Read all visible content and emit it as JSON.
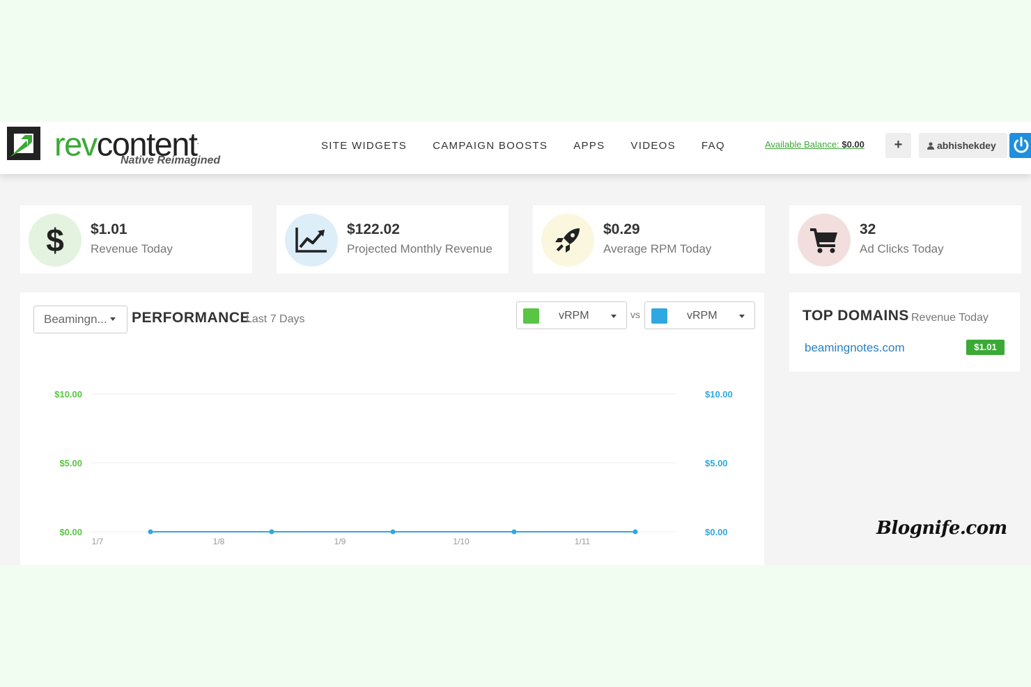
{
  "brand": {
    "name_prefix": "rev",
    "name_suffix": "content",
    "dot": ".",
    "tagline": "Native Reimagined",
    "accent_color": "#3aaa35"
  },
  "nav": {
    "items": [
      {
        "label": "SITE WIDGETS"
      },
      {
        "label": "CAMPAIGN BOOSTS"
      },
      {
        "label": "APPS"
      },
      {
        "label": "VIDEOS"
      },
      {
        "label": "FAQ"
      }
    ]
  },
  "account": {
    "balance_label": "Available Balance:",
    "balance_value": "$0.00",
    "add_label": "+",
    "username": "abhishekdey",
    "power_icon": "power-icon"
  },
  "stats": [
    {
      "value": "$1.01",
      "label": "Revenue Today",
      "icon": "dollar-icon",
      "circle_color": "#e3f3df"
    },
    {
      "value": "$122.02",
      "label": "Projected Monthly Revenue",
      "icon": "trend-chart-icon",
      "circle_color": "#ddeef8"
    },
    {
      "value": "$0.29",
      "label": "Average RPM Today",
      "icon": "rocket-icon",
      "circle_color": "#fbf7df"
    },
    {
      "value": "32",
      "label": "Ad Clicks Today",
      "icon": "cart-icon",
      "circle_color": "#f3dede"
    }
  ],
  "performance": {
    "site_select": "Beamingn...",
    "title": "PERFORMANCE",
    "subtitle": "Last 7 Days",
    "metric_left": {
      "label": "vRPM",
      "color": "#5ac444"
    },
    "vs_label": "vs",
    "metric_right": {
      "label": "vRPM",
      "color": "#2fa8e1"
    }
  },
  "chart_data": {
    "type": "line",
    "categories": [
      "1/7",
      "1/8",
      "1/9",
      "1/10",
      "1/11"
    ],
    "y_left_ticks": [
      "$10.00",
      "$5.00",
      "$0.00"
    ],
    "y_right_ticks": [
      "$10.00",
      "$5.00",
      "$0.00"
    ],
    "ylim": [
      0,
      10
    ],
    "series": [
      {
        "values": [
          0,
          0,
          0,
          0,
          0
        ],
        "color": "#2fa8e1"
      }
    ],
    "grid": true,
    "left_axis_color": "#5ac444",
    "right_axis_color": "#2fa8e1"
  },
  "top_domains": {
    "title": "TOP DOMAINS",
    "subtitle": "Revenue Today",
    "items": [
      {
        "domain": "beamingnotes.com",
        "revenue": "$1.01"
      }
    ]
  },
  "watermark": "Blognife.com"
}
